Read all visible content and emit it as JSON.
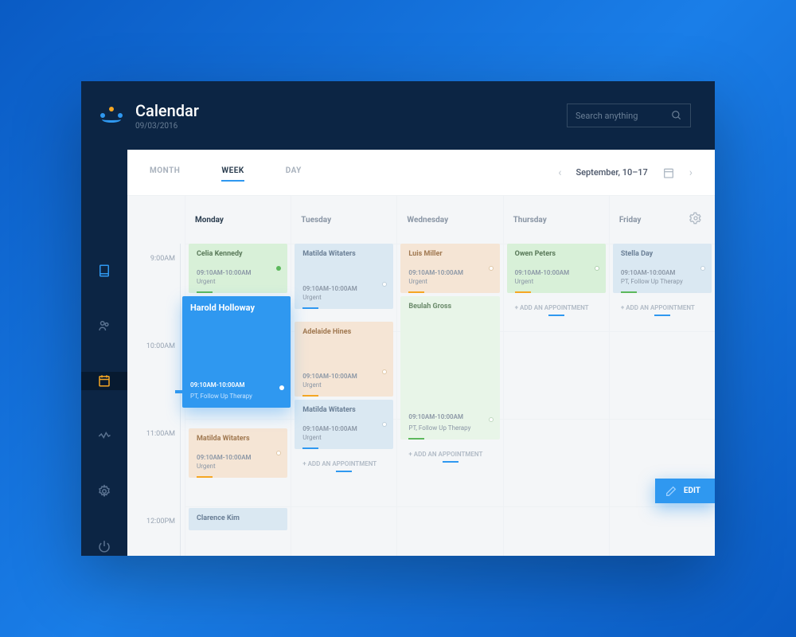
{
  "header": {
    "title": "Calendar",
    "date": "09/03/2016",
    "search_placeholder": "Search anything"
  },
  "tabs": {
    "month": "MONTH",
    "week": "WEEK",
    "day": "DAY"
  },
  "date_nav": {
    "range": "September, 10–17"
  },
  "times": [
    "9:00AM",
    "10:00AM",
    "11:00AM",
    "12:00PM"
  ],
  "days": {
    "mon": "Monday",
    "tue": "Tuesday",
    "wed": "Wednesday",
    "thu": "Thursday",
    "fri": "Friday"
  },
  "add_label": "+ ADD AN APPOINTMENT",
  "edit_label": "EDIT",
  "events": {
    "mon": [
      {
        "name": "Celia Kennedy",
        "time": "09:10AM-10:00AM",
        "tag": "Urgent"
      },
      {
        "name": "Harold Holloway",
        "time": "09:10AM-10:00AM",
        "tag": "PT, Follow Up Therapy"
      },
      {
        "name": "Matilda Witaters",
        "time": "09:10AM-10:00AM",
        "tag": "Urgent"
      },
      {
        "name": "Clarence Kim",
        "time": "",
        "tag": ""
      }
    ],
    "tue": [
      {
        "name": "Matilda Witaters",
        "time": "09:10AM-10:00AM",
        "tag": "Urgent"
      },
      {
        "name": "Adelaide Hines",
        "time": "09:10AM-10:00AM",
        "tag": "Urgent"
      },
      {
        "name": "Matilda Witaters",
        "time": "09:10AM-10:00AM",
        "tag": "Urgent"
      }
    ],
    "wed": [
      {
        "name": "Luis Miller",
        "time": "09:10AM-10:00AM",
        "tag": "Urgent"
      },
      {
        "name": "Beulah Gross",
        "time": "09:10AM-10:00AM",
        "tag": "PT, Follow Up Therapy"
      }
    ],
    "thu": [
      {
        "name": "Owen Peters",
        "time": "09:10AM-10:00AM",
        "tag": "Urgent"
      }
    ],
    "fri": [
      {
        "name": "Stella Day",
        "time": "09:10AM-10:00AM",
        "tag": "PT, Follow Up Therapy"
      }
    ]
  }
}
